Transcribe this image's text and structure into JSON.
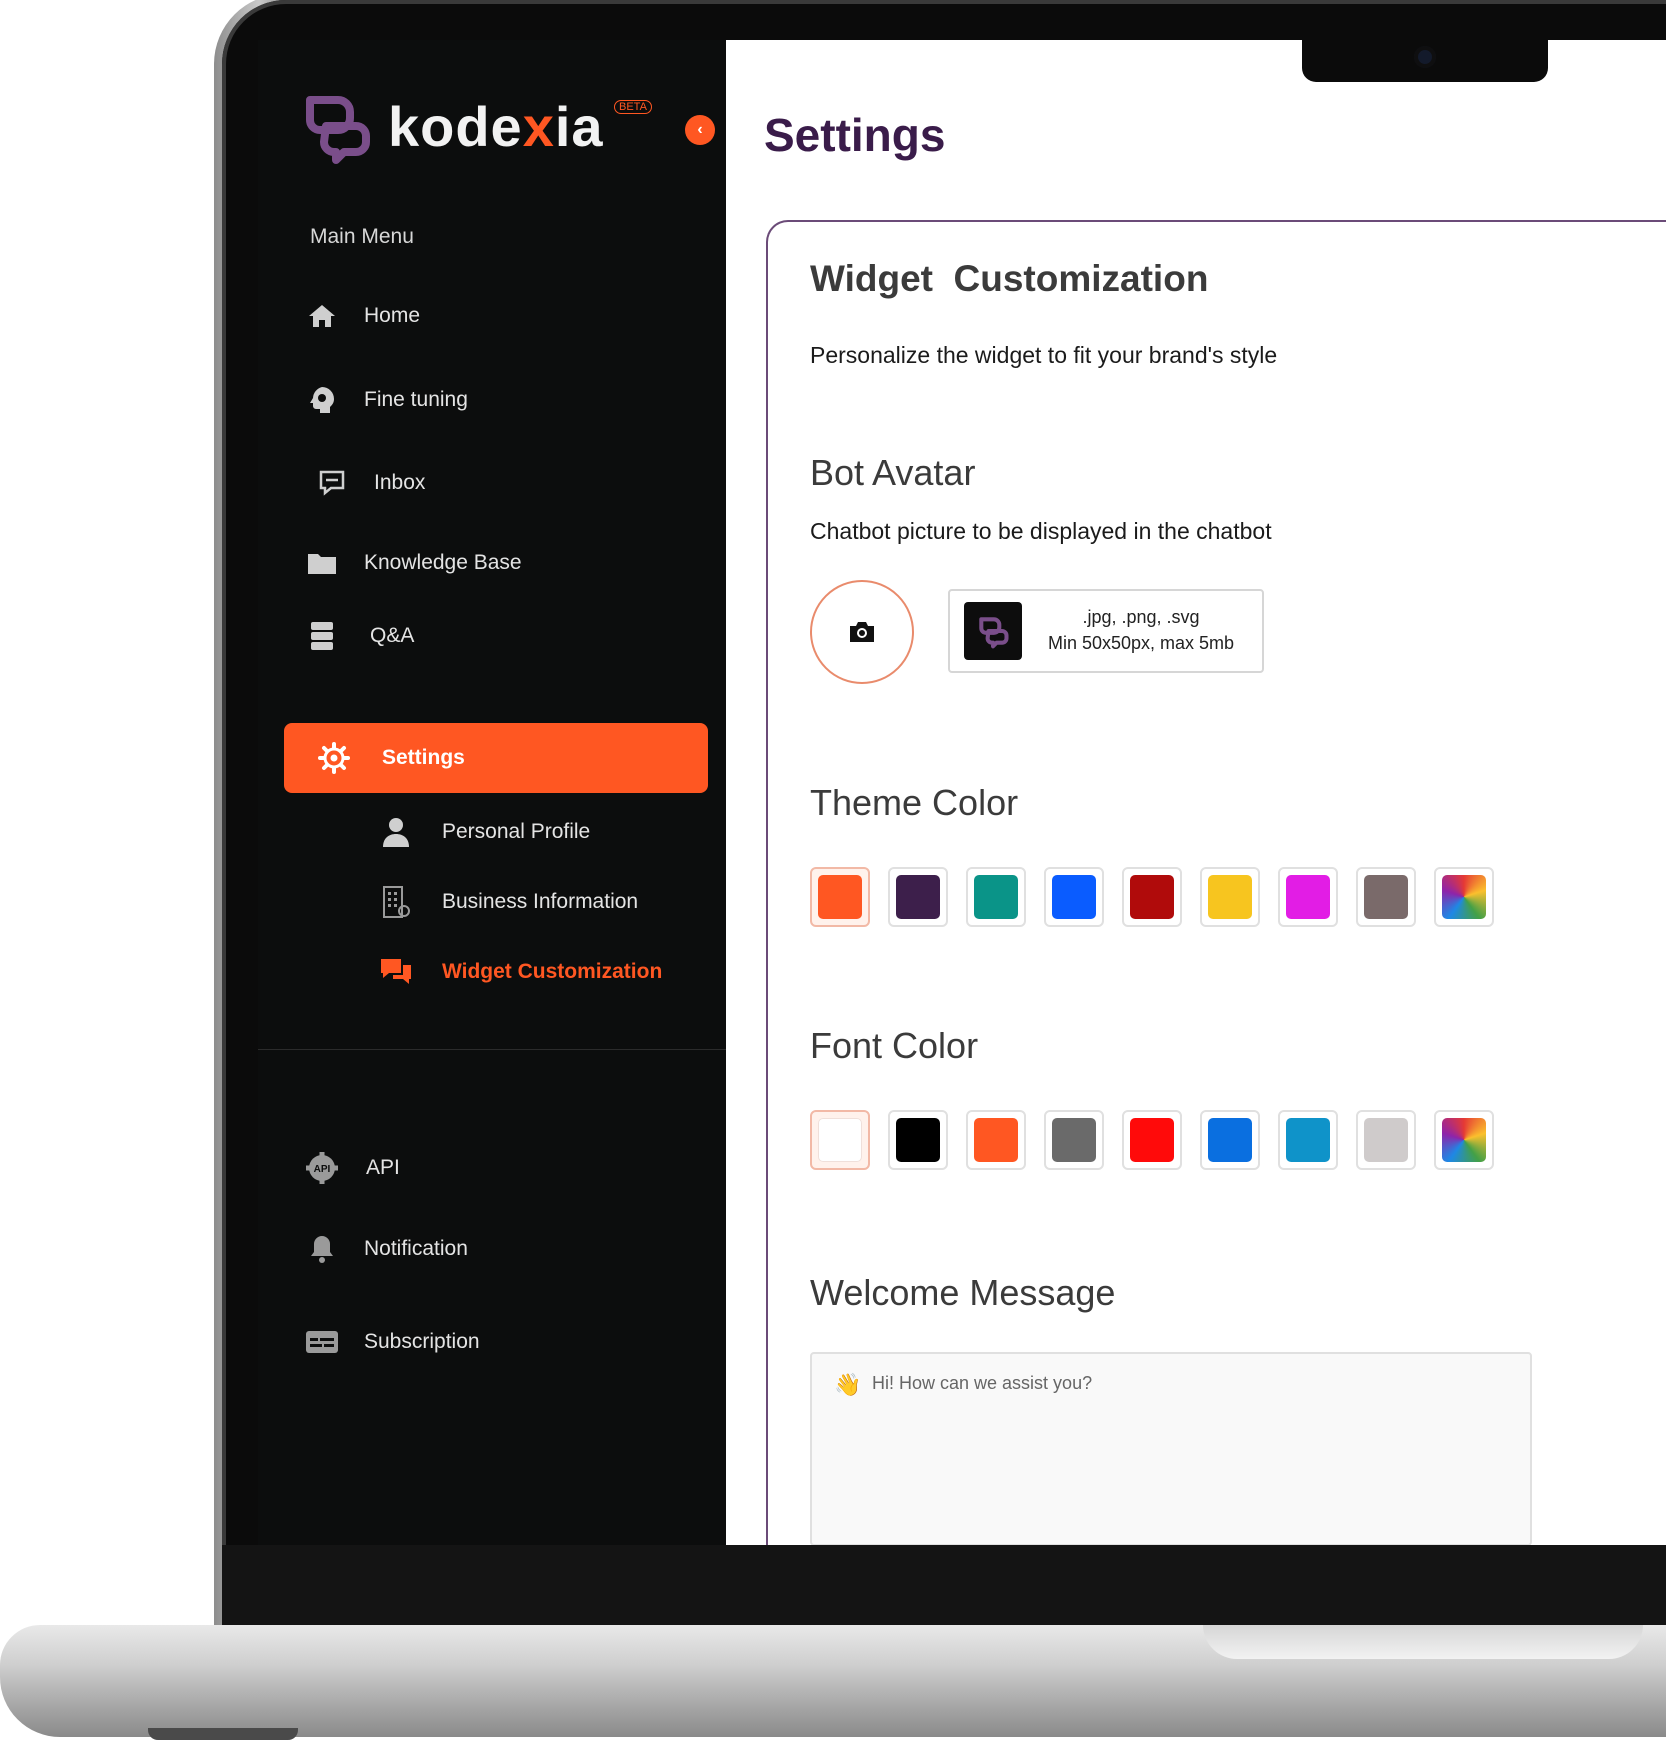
{
  "brand": {
    "name_pre": "kode",
    "name_x": "x",
    "name_post": "ia",
    "beta_badge": "BETA"
  },
  "sidebar": {
    "heading": "Main Menu",
    "items": [
      {
        "label": "Home",
        "icon": "home-icon"
      },
      {
        "label": "Fine tuning",
        "icon": "brain-gear-icon"
      },
      {
        "label": "Inbox",
        "icon": "message-icon"
      },
      {
        "label": "Knowledge Base",
        "icon": "folder-icon"
      },
      {
        "label": "Q&A",
        "icon": "database-icon"
      }
    ],
    "settings": {
      "label": "Settings",
      "icon": "gear-icon"
    },
    "sub_items": [
      {
        "label": "Personal Profile",
        "icon": "user-icon"
      },
      {
        "label": "Business Information",
        "icon": "building-icon"
      },
      {
        "label": "Widget Customization",
        "icon": "chat-bubbles-icon"
      }
    ],
    "bottom_items": [
      {
        "label": "API",
        "icon": "api-gear-icon"
      },
      {
        "label": "Notification",
        "icon": "bell-icon"
      },
      {
        "label": "Subscription",
        "icon": "card-icon"
      }
    ]
  },
  "page": {
    "title": "Settings"
  },
  "widget": {
    "title": "Widget  Customization",
    "description": "Personalize the widget to fit your brand's style",
    "bot_avatar": {
      "title": "Bot Avatar",
      "description": "Chatbot picture to be displayed in the chatbot",
      "formats": ".jpg, .png, .svg",
      "limits": "Min 50x50px, max 5mb"
    },
    "theme_color": {
      "title": "Theme Color",
      "colors": [
        "#ff5722",
        "#3d1f4b",
        "#0a9488",
        "#0a5cff",
        "#b00b0b",
        "#f7c51f",
        "#e21de5",
        "#7a6a6a",
        "multicolor"
      ],
      "selected_index": 0
    },
    "font_color": {
      "title": "Font Color",
      "colors": [
        "#ffffff",
        "#000000",
        "#ff5722",
        "#6a6a6a",
        "#ff0a0a",
        "#0a6fe0",
        "#0f93c9",
        "#cfcbcb",
        "multicolor"
      ],
      "selected_index": 0
    },
    "welcome_message": {
      "title": "Welcome Message",
      "emoji": "👋",
      "placeholder": "Hi! How can we assist you?"
    }
  },
  "colors": {
    "accent": "#ff5722",
    "sidebar_bg": "#0c0d0d",
    "title": "#3a1c4a"
  }
}
